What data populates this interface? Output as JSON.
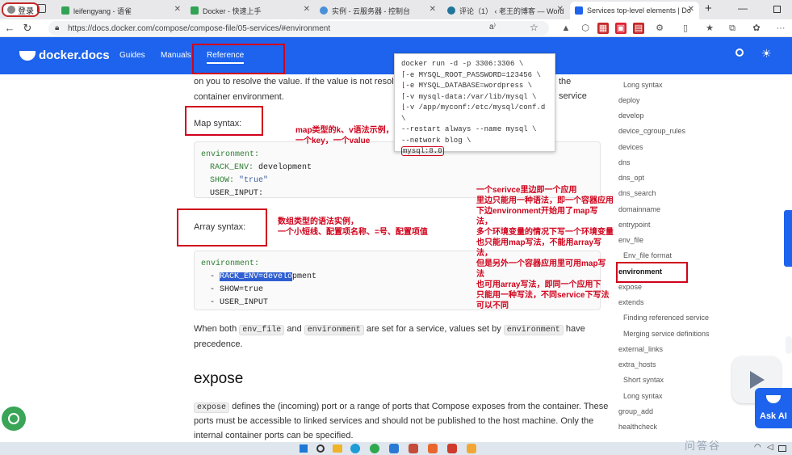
{
  "browser": {
    "login": "登录",
    "tabs": [
      {
        "label": "leifengyang - 语雀",
        "color": "#31a354"
      },
      {
        "label": "Docker - 快速上手",
        "color": "#31a354"
      },
      {
        "label": "实例 - 云服务器 - 控制台",
        "color": "#4a90d9"
      },
      {
        "label": "评论（1） ‹ 老王的博客 — Word",
        "color": "#21759b"
      },
      {
        "label": "Services top-level elements | Do",
        "color": "#1d63ed"
      }
    ],
    "url": "https://docs.docker.com/compose/compose-file/05-services/#environment"
  },
  "nav": {
    "logo": "docker.docs",
    "links": [
      "Guides",
      "Manuals",
      "Reference"
    ]
  },
  "doc": {
    "para1_a": "on you to resolve the value. If the value is not resolved",
    "para1_b": "the service",
    "para1_c": "container environment.",
    "map_title": "Map syntax:",
    "map_code": {
      "l1": "environment:",
      "l2k": "RACK_ENV:",
      "l2v": " development",
      "l3k": "SHOW:",
      "l3v": " \"true\"",
      "l4": "USER_INPUT:"
    },
    "array_title": "Array syntax:",
    "array_code": {
      "l1": "environment:",
      "l2a": "- ",
      "l2sel": "RACK_ENV=develo",
      "l2b": "pment",
      "l3": "- SHOW=true",
      "l4": "- USER_INPUT"
    },
    "para2": {
      "a": "When both ",
      "c1": "env_file",
      "b": " and ",
      "c2": "environment",
      "c": " are set for a service, values set by ",
      "c3": "environment",
      "d": " have",
      "e": "precedence."
    },
    "expose_title": "expose",
    "expose": {
      "c": "expose",
      "a": " defines the (incoming) port or a range of ports that Compose exposes from the container. These",
      "b": "ports must be accessible to linked services and should not be published to the host machine. Only the",
      "d": "internal container ports can be specified."
    }
  },
  "annotations": {
    "map": [
      "map类型的k、v语法示例，",
      "一个key，一个value"
    ],
    "array": [
      "数组类型的语法实例，",
      "一个小短线、配置项名称、=号、配置项值"
    ],
    "service": [
      "一个serivce里边即一个应用",
      "里边只能用一种语法，即一个容器应用",
      "下边environment开始用了map写法，",
      "多个环境变量的情况下写一个环境变量",
      "也只能用map写法，不能用array写法，",
      "但是另外一个容器应用里可用map写法",
      "也可用array写法，即同一个应用下",
      "只能用一种写法，不同service下写法",
      "可以不同"
    ]
  },
  "snippet": {
    "lines": [
      "docker run -d -p 3306:3306 \\",
      "-e MYSQL_ROOT_PASSWORD=123456 \\",
      "-e MYSQL_DATABASE=wordpress \\",
      "-v mysql-data:/var/lib/mysql \\",
      "-v /app/myconf:/etc/mysql/conf.d \\",
      "--restart always --name mysql \\",
      "--network blog \\",
      "mysql:8.0"
    ]
  },
  "toc": [
    "Long syntax",
    "deploy",
    "develop",
    "device_cgroup_rules",
    "devices",
    "dns",
    "dns_opt",
    "dns_search",
    "domainname",
    "entrypoint",
    "env_file",
    "Env_file format",
    "environment",
    "expose",
    "extends",
    "Finding referenced service",
    "Merging service definitions",
    "external_links",
    "extra_hosts",
    "Short syntax",
    "Long syntax",
    "group_add",
    "healthcheck"
  ],
  "widgets": {
    "ask_ai": "Ask AI",
    "watermark": "问答谷"
  }
}
